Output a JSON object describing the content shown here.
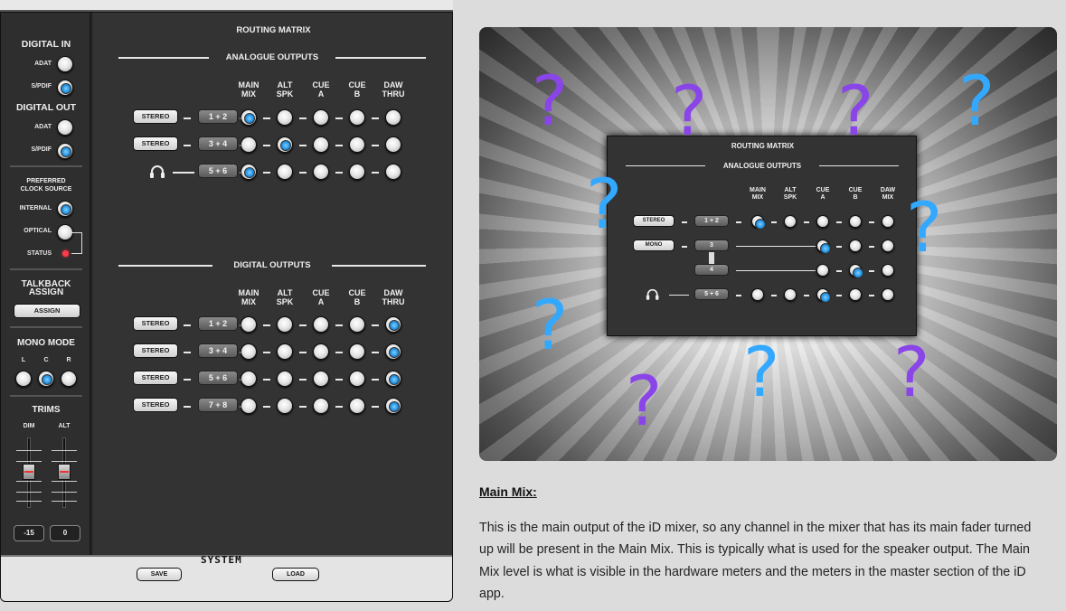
{
  "sidebar": {
    "digital_in": "DIGITAL IN",
    "adat": "ADAT",
    "spdif": "S/PDIF",
    "digital_out": "DIGITAL OUT",
    "preferred_clock": [
      "PREFERRED",
      "CLOCK SOURCE"
    ],
    "internal": "INTERNAL",
    "optical": "OPTICAL",
    "status": "STATUS",
    "talkback": [
      "TALKBACK",
      "ASSIGN"
    ],
    "assign_btn": "ASSIGN",
    "mono_mode": "MONO MODE",
    "mono_l": "L",
    "mono_c": "C",
    "mono_r": "R",
    "trims": "TRIMS",
    "dim": "DIM",
    "alt": "ALT",
    "dim_value": "-15",
    "alt_value": "0"
  },
  "matrix": {
    "title": "ROUTING MATRIX",
    "analogue_title": "ANALOGUE OUTPUTS",
    "digital_title": "DIGITAL OUTPUTS",
    "columns": [
      [
        "MAIN",
        "MIX"
      ],
      [
        "ALT",
        "SPK"
      ],
      [
        "CUE",
        "A"
      ],
      [
        "CUE",
        "B"
      ],
      [
        "DAW",
        "THRU"
      ]
    ],
    "analogue_rows": [
      {
        "mode": "STEREO",
        "chan": "1 + 2",
        "selected": 0
      },
      {
        "mode": "STEREO",
        "chan": "3 + 4",
        "selected": 1
      },
      {
        "mode": "headphones-icon",
        "chan": "5 + 6",
        "selected": 0
      }
    ],
    "digital_rows": [
      {
        "mode": "STEREO",
        "chan": "1 + 2",
        "selected": 4
      },
      {
        "mode": "STEREO",
        "chan": "3 + 4",
        "selected": 4
      },
      {
        "mode": "STEREO",
        "chan": "5 + 6",
        "selected": 4
      },
      {
        "mode": "STEREO",
        "chan": "7 + 8",
        "selected": 4
      }
    ]
  },
  "bottom": {
    "save": "SAVE",
    "system": "SYSTEM",
    "load": "LOAD"
  },
  "hero": {
    "title": "ROUTING MATRIX",
    "subtitle": "ANALOGUE OUTPUTS",
    "columns": [
      [
        "MAIN",
        "MIX"
      ],
      [
        "ALT",
        "SPK"
      ],
      [
        "CUE",
        "A"
      ],
      [
        "CUE",
        "B"
      ],
      [
        "DAW",
        "MIX"
      ]
    ],
    "stereo": "STEREO",
    "stereo_chan": "1 + 2",
    "mono": "MONO",
    "mono_chan_a": "3",
    "mono_chan_b": "4",
    "hp_chan": "5 + 6",
    "question_mark": "?",
    "question_colors": [
      "#33a8ff",
      "#8a45e8"
    ]
  },
  "article": {
    "heading": "Main Mix:",
    "body": "This is the main output of the iD mixer, so any channel in the mixer that has its main fader turned up will be present in the Main Mix. This is typically what is used for the speaker output. The Main Mix level is what is visible in the hardware meters and the meters in the master section of the iD app."
  }
}
